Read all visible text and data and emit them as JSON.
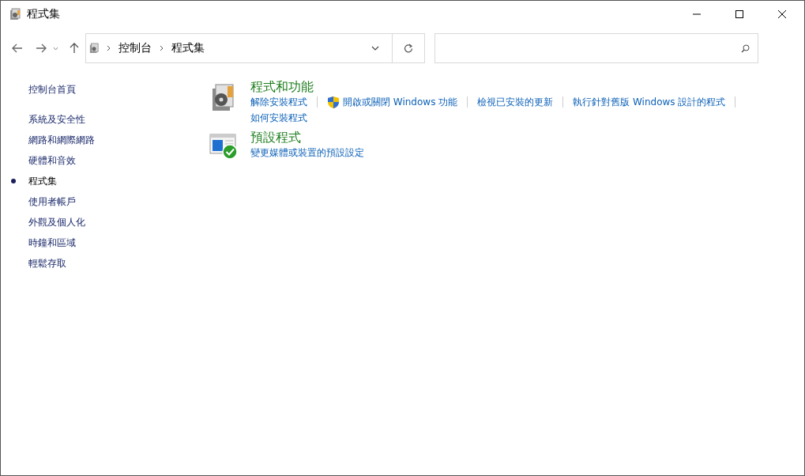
{
  "window": {
    "title": "程式集"
  },
  "breadcrumb": [
    "控制台",
    "程式集"
  ],
  "sidebar": {
    "items": [
      {
        "label": "控制台首頁",
        "selected": false,
        "kind": "home"
      },
      {
        "label": "系統及安全性",
        "selected": false,
        "kind": "category"
      },
      {
        "label": "網路和網際網路",
        "selected": false,
        "kind": "category"
      },
      {
        "label": "硬體和音效",
        "selected": false,
        "kind": "category"
      },
      {
        "label": "程式集",
        "selected": true,
        "kind": "category"
      },
      {
        "label": "使用者帳戶",
        "selected": false,
        "kind": "category"
      },
      {
        "label": "外觀及個人化",
        "selected": false,
        "kind": "category"
      },
      {
        "label": "時鐘和區域",
        "selected": false,
        "kind": "category"
      },
      {
        "label": "輕鬆存取",
        "selected": false,
        "kind": "category"
      }
    ]
  },
  "categories": [
    {
      "kind": "programs",
      "title": "程式和功能",
      "links": [
        {
          "text": "解除安裝程式",
          "shield": false
        },
        {
          "text": "開啟或關閉 Windows 功能",
          "shield": true
        },
        {
          "text": "檢視已安裝的更新",
          "shield": false
        },
        {
          "text": "執行針對舊版 Windows 設計的程式",
          "shield": false
        },
        {
          "text": "如何安裝程式",
          "shield": false
        }
      ]
    },
    {
      "kind": "defaults",
      "title": "預設程式",
      "links": [
        {
          "text": "變更媒體或裝置的預設設定",
          "shield": false
        }
      ]
    }
  ]
}
